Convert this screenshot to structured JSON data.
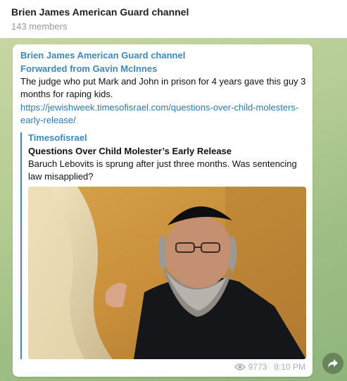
{
  "header": {
    "title": "Brien James American Guard channel",
    "subtitle": "143 members"
  },
  "message": {
    "channel_name": "Brien James American Guard channel",
    "forwarded_from": "Forwarded from Gavin McInnes",
    "text": "The judge who put Mark and John in prison for 4 years gave this guy 3 months for raping kids.",
    "link": "https://jewishweek.timesofisrael.com/questions-over-child-molesters-early-release/",
    "preview": {
      "site_name": "Timesofisrael",
      "title": "Questions Over Child Molester’s Early Release",
      "description": "Baruch Lebovits is sprung after just three months. Was sentencing law misapplied?",
      "image_icon": "photo-courtroom-man"
    },
    "views": "9773",
    "time": "8:10 PM"
  },
  "icons": {
    "views": "eye-icon",
    "share": "share-arrow-icon"
  },
  "colors": {
    "accent": "#3a8ac3",
    "link": "#2a7ab8",
    "meta": "#a6b1bb"
  }
}
